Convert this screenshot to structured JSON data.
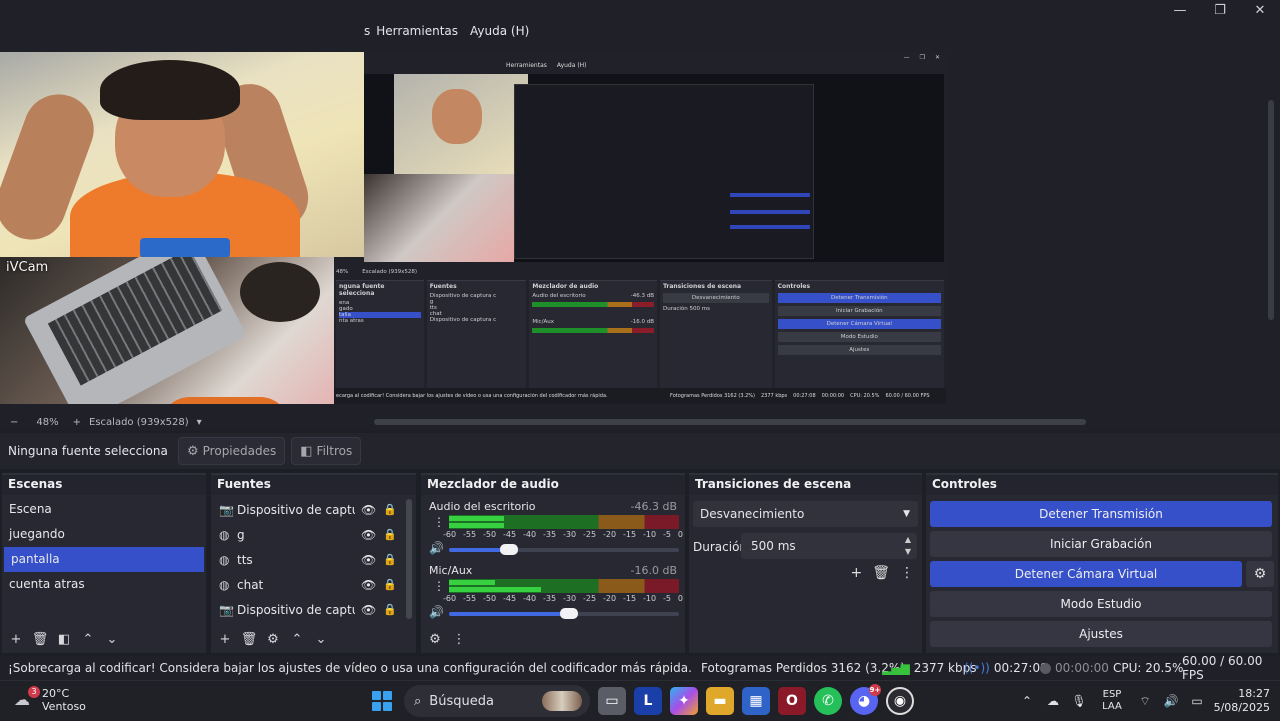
{
  "window": {
    "minimize": "—",
    "restore": "❐",
    "close": "✕"
  },
  "menubar": {
    "partial": "s",
    "items": [
      "Herramientas",
      "Ayuda (H)"
    ]
  },
  "preview": {
    "cam_label": "iVCam",
    "nested": {
      "menu": [
        "Herramientas",
        "Ayuda (H)"
      ],
      "tabs": [
        "nguna fuente selecciona",
        "Propiedades",
        "Filtros"
      ],
      "scenes": [
        "ena",
        "gado",
        "talla",
        "nta atras"
      ],
      "sources": [
        "Dispositivo de captura c",
        "g",
        "tts",
        "chat",
        "Dispositivo de captura c"
      ],
      "mixer_title": "Mezclador de audio",
      "transitions_title": "Transiciones de escena",
      "controls_title": "Controles",
      "scenes_title": "",
      "sources_title": "Fuentes",
      "mixer_ch1": "Audio del escritorio",
      "mixer_ch1_db": "-46.3 dB",
      "mixer_ch2": "Mic/Aux",
      "mixer_ch2_db": "-16.0 dB",
      "trans_select": "Desvanecimiento",
      "duration_label": "Duración",
      "duration_value": "500 ms",
      "controls": [
        "Detener Transmisión",
        "Iniciar Grabación",
        "Detener Cámara Virtual",
        "Modo Estudio",
        "Ajustes"
      ],
      "status": "ecarga al codificar! Considera bajar los ajustes de vídeo o usa una configuración del codificador más rápida.",
      "status_frames": "Fotogramas Perdidos 3162 (3.2%)",
      "status_kbps": "2377 kbps",
      "status_time": "00:27:08",
      "status_rec": "00:00:00",
      "status_cpu": "CPU: 20.5%",
      "status_fps": "60.00 / 60.00 FPS",
      "zoom": "48%",
      "scale": "Escalado (939x528)"
    }
  },
  "zoom_bar": {
    "minus": "−",
    "zoom": "48%",
    "plus": "+",
    "scale": "Escalado (939x528)",
    "caret": "▾"
  },
  "source_toolbar": {
    "no_source": "Ninguna fuente selecciona",
    "properties": "Propiedades",
    "filters": "Filtros"
  },
  "docks": {
    "scenes": {
      "title": "Escenas",
      "items": [
        "Escena",
        "juegando",
        "pantalla",
        "cuenta atras"
      ],
      "active_index": 2
    },
    "sources": {
      "title": "Fuentes",
      "items": [
        {
          "icon": "camera-icon",
          "name": "Dispositivo de captura c",
          "glyph": "📷"
        },
        {
          "icon": "globe-icon",
          "name": "g",
          "glyph": "◍"
        },
        {
          "icon": "globe-icon",
          "name": "tts",
          "glyph": "◍"
        },
        {
          "icon": "globe-icon",
          "name": "chat",
          "glyph": "◍"
        },
        {
          "icon": "camera-icon",
          "name": "Dispositivo de captura c",
          "glyph": "📷"
        }
      ]
    },
    "mixer": {
      "title": "Mezclador de audio",
      "channels": [
        {
          "name": "Audio del escritorio",
          "db": "-46.3 dB",
          "level_pct": 24,
          "level2_pct": 24,
          "volume_pct": 26
        },
        {
          "name": "Mic/Aux",
          "db": "-16.0 dB",
          "level_pct": 20,
          "level2_pct": 40,
          "volume_pct": 52
        }
      ],
      "ticks": [
        "-60",
        "-55",
        "-50",
        "-45",
        "-40",
        "-35",
        "-30",
        "-25",
        "-20",
        "-15",
        "-10",
        "-5",
        "0"
      ]
    },
    "transitions": {
      "title": "Transiciones de escena",
      "selected": "Desvanecimiento",
      "duration_label": "Duración",
      "duration_value": "500 ms"
    },
    "controls": {
      "title": "Controles",
      "buttons": [
        "Detener Transmisión",
        "Iniciar Grabación",
        "Detener Cámara Virtual",
        "Modo Estudio",
        "Ajustes"
      ]
    }
  },
  "statusbar": {
    "message": "¡Sobrecarga al codificar! Considera bajar los ajustes de vídeo o usa una configuración del codificador más rápida.",
    "frames": "Fotogramas Perdidos 3162 (3.2%)",
    "kbps": "2377 kbps",
    "stream_time": "00:27:08",
    "rec_time": "00:00:00",
    "cpu": "CPU: 20.5%",
    "fps": "60.00 / 60.00 FPS"
  },
  "taskbar": {
    "weather_temp": "20°C",
    "weather_desc": "Ventoso",
    "weather_badge": "3",
    "search_placeholder": "Búsqueda",
    "lang_1": "ESP",
    "lang_2": "LAA",
    "time": "18:27",
    "date": "5/08/2025",
    "discord_badge": "9+",
    "app_l_label": "L"
  },
  "colors": {
    "accent": "#3550c8",
    "meter_green": "#37d040",
    "status_green": "#37c13d"
  }
}
